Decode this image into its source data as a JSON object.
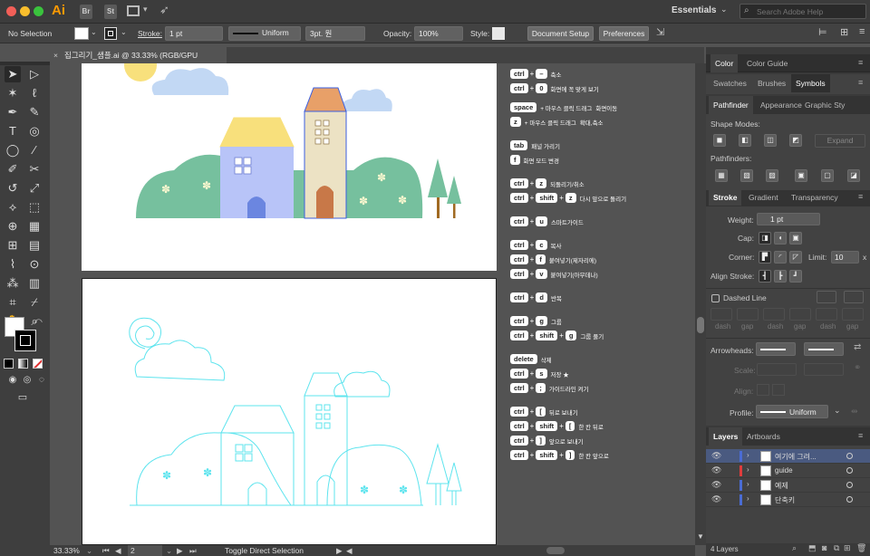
{
  "menubar": {
    "app": "Ai",
    "bridge": "Br",
    "stock": "St",
    "workspace": "Essentials",
    "search_placeholder": "Search Adobe Help"
  },
  "controlbar": {
    "selection": "No Selection",
    "stroke_label": "Stroke:",
    "stroke_weight": "1 pt",
    "stroke_profile": "Uniform",
    "brush": "3pt. 원",
    "opacity_label": "Opacity:",
    "opacity": "100%",
    "style_label": "Style:",
    "document_setup": "Document Setup",
    "preferences": "Preferences"
  },
  "document": {
    "tab_title": "집그리기_샘플.ai @ 33.33% (RGB/GPU Preview)"
  },
  "shortcuts": [
    {
      "keys": [
        "ctrl",
        "–"
      ],
      "desc": "축소"
    },
    {
      "keys": [
        "ctrl",
        "0"
      ],
      "desc": "화면에 꼭 맞게 보기"
    },
    {
      "keys": [
        "space"
      ],
      "note": "+ 마우스 클릭 드래그",
      "desc": "화면이동"
    },
    {
      "keys": [
        "z"
      ],
      "note": "+ 마우스 클릭 드래그",
      "desc": "확대,축소"
    },
    {
      "keys": [
        "tab"
      ],
      "desc": "패널 가리기"
    },
    {
      "keys": [
        "f"
      ],
      "desc": "화면 모드 변경"
    },
    {
      "keys": [
        "ctrl",
        "z"
      ],
      "desc": "되돌리기/취소"
    },
    {
      "keys": [
        "ctrl",
        "shift",
        "z"
      ],
      "desc": "다시 앞으로 돌리기"
    },
    {
      "keys": [
        "ctrl",
        "u"
      ],
      "desc": "스마트가이드"
    },
    {
      "keys": [
        "ctrl",
        "c"
      ],
      "desc": "복사"
    },
    {
      "keys": [
        "ctrl",
        "f"
      ],
      "desc": "붙여넣기(제자리에)"
    },
    {
      "keys": [
        "ctrl",
        "v"
      ],
      "desc": "붙여넣기(아무데나)"
    },
    {
      "keys": [
        "ctrl",
        "d"
      ],
      "desc": "반복"
    },
    {
      "keys": [
        "ctrl",
        "g"
      ],
      "desc": "그룹"
    },
    {
      "keys": [
        "ctrl",
        "shift",
        "g"
      ],
      "desc": "그룹 풀기"
    },
    {
      "keys": [
        "delete"
      ],
      "desc": "삭제"
    },
    {
      "keys": [
        "ctrl",
        "s"
      ],
      "desc": "저장 ★"
    },
    {
      "keys": [
        "ctrl",
        ";"
      ],
      "desc": "가이드라인 켜기"
    },
    {
      "keys": [
        "ctrl",
        "["
      ],
      "desc": "뒤로 보내기"
    },
    {
      "keys": [
        "ctrl",
        "shift",
        "["
      ],
      "desc": "한 칸 뒤로"
    },
    {
      "keys": [
        "ctrl",
        "]"
      ],
      "desc": "앞으로 보내기"
    },
    {
      "keys": [
        "ctrl",
        "shift",
        "]"
      ],
      "desc": "한 칸 앞으로"
    }
  ],
  "statusbar": {
    "zoom": "33.33%",
    "artboard": "2",
    "message": "Toggle Direct Selection"
  },
  "panels": {
    "color_tabs": [
      "Color",
      "Color Guide"
    ],
    "swatch_tabs": [
      "Swatches",
      "Brushes",
      "Symbols"
    ],
    "pathfinder_tabs": [
      "Pathfinder",
      "Appearance",
      "Graphic Sty"
    ],
    "shape_modes": "Shape Modes:",
    "expand": "Expand",
    "pathfinders": "Pathfinders:",
    "stroke_tabs": [
      "Stroke",
      "Gradient",
      "Transparency"
    ],
    "weight_label": "Weight:",
    "weight": "1 pt",
    "cap_label": "Cap:",
    "corner_label": "Corner:",
    "limit_label": "Limit:",
    "limit": "10",
    "limit_unit": "x",
    "align_stroke": "Align Stroke:",
    "dashed_line": "Dashed Line",
    "dash_labels": [
      "dash",
      "gap",
      "dash",
      "gap",
      "dash",
      "gap"
    ],
    "arrowheads": "Arrowheads:",
    "scale": "Scale:",
    "align": "Align:",
    "profile_label": "Profile:",
    "profile": "Uniform",
    "layers_tabs": [
      "Layers",
      "Artboards"
    ],
    "layers": [
      {
        "name": "여기에 그려...",
        "color": "#4a6cd4"
      },
      {
        "name": "guide",
        "color": "#e03c3c"
      },
      {
        "name": "예제",
        "color": "#4a6cd4"
      },
      {
        "name": "단축키",
        "color": "#4a6cd4"
      }
    ],
    "layers_count": "4 Layers"
  },
  "colors": {
    "house_blue": "#b8c4f8",
    "roof_yellow": "#f8e07c",
    "tower_beige": "#ece2c4",
    "roof_orange": "#e8a068",
    "bush_green": "#76c09e",
    "door_brown": "#c87848",
    "outline_cyan": "#5ee4ee",
    "selection_blue": "#3b5fe0"
  }
}
